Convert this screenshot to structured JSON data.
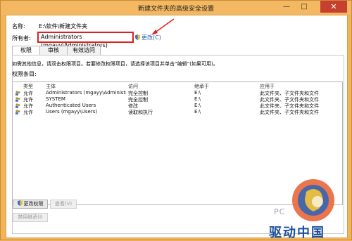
{
  "window": {
    "title": "新建文件夹的高级安全设置",
    "minimize_glyph": "—",
    "maximize_glyph": "□",
    "close_glyph": "✕"
  },
  "fields": {
    "name_label": "名称:",
    "name_value": "E:\\软件\\新建文件夹",
    "owner_label": "所有者:",
    "owner_value": "Administrators (mgayy\\Administrators)",
    "change_link": "更改(C)"
  },
  "tabs": [
    {
      "label": "权限",
      "active": true
    },
    {
      "label": "审核",
      "active": false
    },
    {
      "label": "有效访问",
      "active": false
    }
  ],
  "info_text": "如需其他信息，请双击权限项目。若要修改权限项目，请选择该项目并单击“编辑”(如果可用)。",
  "entries_label": "权限条目:",
  "table": {
    "headers": [
      "类型",
      "主体",
      "访问",
      "继承于",
      "应用于"
    ],
    "rows": [
      {
        "type": "允许",
        "principal": "Administrators (mgayy\\Administrat...",
        "access": "完全控制",
        "inherited": "E:\\",
        "applies": "此文件夹、子文件夹和文件"
      },
      {
        "type": "允许",
        "principal": "SYSTEM",
        "access": "完全控制",
        "inherited": "E:\\",
        "applies": "此文件夹、子文件夹和文件"
      },
      {
        "type": "允许",
        "principal": "Authenticated Users",
        "access": "修改",
        "inherited": "E:\\",
        "applies": "此文件夹、子文件夹和文件"
      },
      {
        "type": "允许",
        "principal": "Users (mgayy\\Users)",
        "access": "读取和执行",
        "inherited": "E:\\",
        "applies": "此文件夹、子文件夹和文件"
      }
    ]
  },
  "buttons": {
    "change_permissions": "更改权限",
    "view": "查看(V)",
    "disable_inheritance": "禁用继承(I)"
  },
  "watermark": {
    "pc_text": "PC",
    "brand_text": "驱动中国"
  },
  "colors": {
    "highlight_box": "#e02020",
    "link": "#1a5cb0",
    "window_frame": "#f0b459",
    "close_button": "#c7402d"
  }
}
